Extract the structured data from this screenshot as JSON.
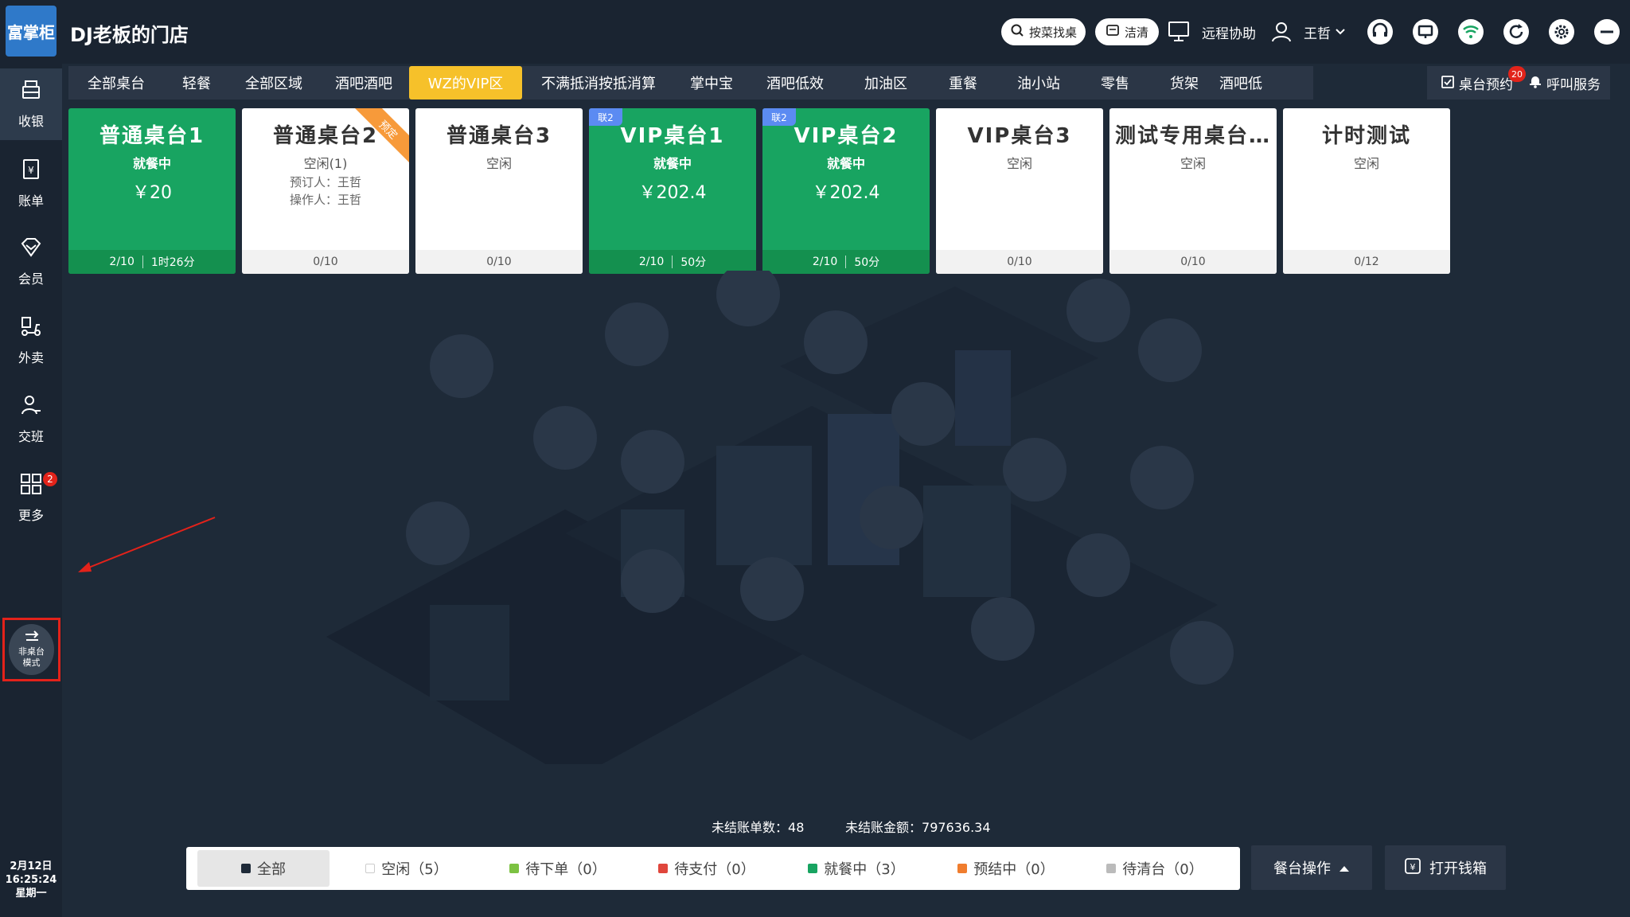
{
  "header": {
    "logo_text": "富掌柜",
    "store_name": "DJ老板的门店",
    "search_btn": "按菜找桌",
    "clean_btn": "洁清",
    "remote_help": "远程协助",
    "user_name": "王哲"
  },
  "sidebar": {
    "items": [
      {
        "label": "收银",
        "icon": "cashier-icon"
      },
      {
        "label": "账单",
        "icon": "bill-icon"
      },
      {
        "label": "会员",
        "icon": "member-icon"
      },
      {
        "label": "外卖",
        "icon": "delivery-icon"
      },
      {
        "label": "交班",
        "icon": "shift-icon"
      },
      {
        "label": "更多",
        "icon": "more-grid-icon",
        "badge": "2"
      }
    ],
    "mode_btn": {
      "line1": "非桌台",
      "line2": "模式"
    },
    "date": "2月12日",
    "time": "16:25:24",
    "weekday": "星期一"
  },
  "tabs": [
    "全部桌台",
    "轻餐",
    "全部区域",
    "酒吧酒吧",
    "WZ的VIP区",
    "不满抵消按抵消算",
    "掌中宝",
    "酒吧低效",
    "加油区",
    "重餐",
    "油小站",
    "零售",
    "货架",
    "酒吧低"
  ],
  "active_tab": "WZ的VIP区",
  "right_actions": {
    "reserve": "桌台预约",
    "reserve_badge": "20",
    "call": "呼叫服务"
  },
  "tables": [
    {
      "name": "普通桌台1",
      "status": "就餐中",
      "amount": "￥20",
      "seats": "2/10",
      "duration": "1时26分",
      "busy": true
    },
    {
      "name": "普通桌台2",
      "status": "空闲(1)",
      "reserver": "预订人：王哲",
      "operator": "操作人：王哲",
      "seats": "0/10",
      "ribbon": "预定",
      "busy": false
    },
    {
      "name": "普通桌台3",
      "status": "空闲",
      "seats": "0/10",
      "busy": false
    },
    {
      "name": "VIP桌台1",
      "status": "就餐中",
      "amount": "￥202.4",
      "seats": "2/10",
      "duration": "50分",
      "tag": "联2",
      "busy": true
    },
    {
      "name": "VIP桌台2",
      "status": "就餐中",
      "amount": "￥202.4",
      "seats": "2/10",
      "duration": "50分",
      "tag": "联2",
      "busy": true
    },
    {
      "name": "VIP桌台3",
      "status": "空闲",
      "seats": "0/10",
      "busy": false
    },
    {
      "name": "测试专用桌台…",
      "status": "空闲",
      "seats": "0/10",
      "busy": false
    },
    {
      "name": "计时测试",
      "status": "空闲",
      "seats": "0/12",
      "busy": false
    }
  ],
  "summary": {
    "unsettled_count_label": "未结账单数：",
    "unsettled_count": "48",
    "unsettled_amount_label": "未结账金额：",
    "unsettled_amount": "797636.34"
  },
  "legend": [
    {
      "label": "全部",
      "color": "#1e2a38"
    },
    {
      "label": "空闲（5）",
      "color": "#ffffff"
    },
    {
      "label": "待下单（0）",
      "color": "#7cc242"
    },
    {
      "label": "待支付（0）",
      "color": "#e0463c"
    },
    {
      "label": "就餐中（3）",
      "color": "#18a461"
    },
    {
      "label": "预结中（0）",
      "color": "#f07d2e"
    },
    {
      "label": "待清台（0）",
      "color": "#bbbbbb"
    }
  ],
  "bottom_buttons": {
    "table_ops": "餐台操作",
    "open_drawer": "打开钱箱"
  },
  "colors": {
    "busy": "#18a461",
    "active_tab": "#f6c12a",
    "highlight": "#e3221a"
  }
}
